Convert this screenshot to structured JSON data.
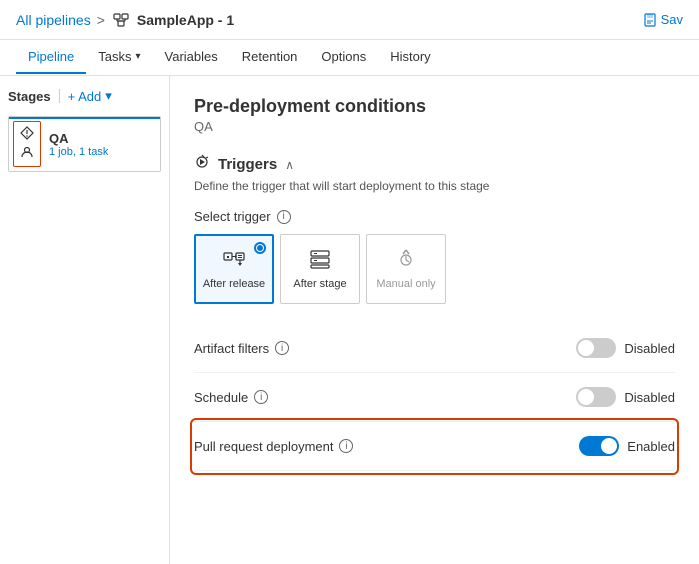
{
  "breadcrumb": {
    "all_pipelines": "All pipelines",
    "separator": ">",
    "app_name": "SampleApp - 1"
  },
  "save_button": "Sav",
  "nav": {
    "tabs": [
      {
        "id": "pipeline",
        "label": "Pipeline",
        "active": true
      },
      {
        "id": "tasks",
        "label": "Tasks",
        "has_arrow": true
      },
      {
        "id": "variables",
        "label": "Variables"
      },
      {
        "id": "retention",
        "label": "Retention"
      },
      {
        "id": "options",
        "label": "Options"
      },
      {
        "id": "history",
        "label": "History"
      }
    ]
  },
  "sidebar": {
    "stages_label": "Stages",
    "add_label": "+ Add",
    "stage": {
      "name": "QA",
      "meta": "1 job, 1 task"
    }
  },
  "content": {
    "title": "Pre-deployment conditions",
    "subtitle": "QA",
    "triggers_section": {
      "icon": "⚡",
      "label": "Triggers",
      "description": "Define the trigger that will start deployment to this stage",
      "select_trigger_label": "Select trigger",
      "options": [
        {
          "id": "after-release",
          "label": "After release",
          "icon": "🏭",
          "selected": true,
          "disabled": false
        },
        {
          "id": "after-stage",
          "label": "After stage",
          "icon": "▤",
          "selected": false,
          "disabled": false
        },
        {
          "id": "manual-only",
          "label": "Manual only",
          "icon": "⚡",
          "selected": false,
          "disabled": true
        }
      ]
    },
    "artifact_filters": {
      "label": "Artifact filters",
      "status": "Disabled",
      "enabled": false
    },
    "schedule": {
      "label": "Schedule",
      "status": "Disabled",
      "enabled": false
    },
    "pull_request": {
      "label": "Pull request deployment",
      "status": "Enabled",
      "enabled": true,
      "highlighted": true
    }
  }
}
